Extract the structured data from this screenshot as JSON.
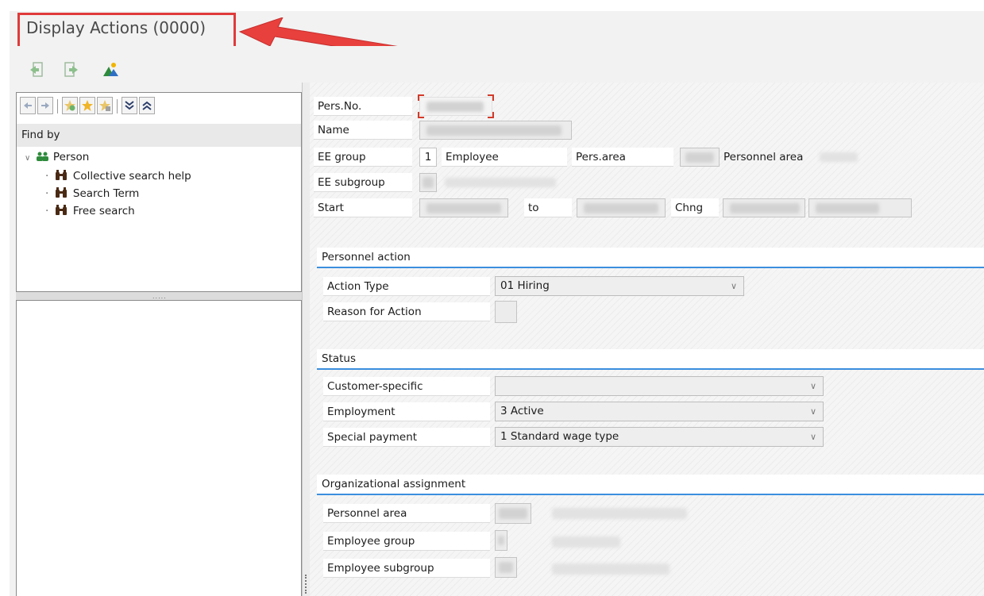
{
  "window": {
    "title": "Display Actions (0000)"
  },
  "toolbar": {
    "buttons": [
      "back-to-list-icon",
      "forward-icon",
      "org-structure-icon"
    ]
  },
  "navigator": {
    "toolbar_icons": [
      "arrow-left-icon",
      "arrow-right-icon",
      "add-favorite-icon",
      "star-icon",
      "delete-favorite-icon",
      "expand-all-icon",
      "collapse-all-icon"
    ],
    "find_by_label": "Find by",
    "tree": {
      "root_label": "Person",
      "children": [
        "Collective search help",
        "Search Term",
        "Free search"
      ]
    }
  },
  "header": {
    "pers_no_label": "Pers.No.",
    "name_label": "Name",
    "ee_group_label": "EE group",
    "ee_group_value": "1",
    "ee_group_text": "Employee",
    "pers_area_label": "Pers.area",
    "personnel_area_text": "Personnel area",
    "ee_subgroup_label": "EE subgroup",
    "start_label": "Start",
    "to_label": "to",
    "chng_label": "Chng"
  },
  "personnel_action": {
    "title": "Personnel action",
    "action_type_label": "Action Type",
    "action_type_value": "01 Hiring",
    "reason_label": "Reason for Action"
  },
  "status": {
    "title": "Status",
    "customer_label": "Customer-specific",
    "customer_value": "",
    "employment_label": "Employment",
    "employment_value": "3 Active",
    "special_payment_label": "Special payment",
    "special_payment_value": "1 Standard wage type"
  },
  "org_assignment": {
    "title": "Organizational assignment",
    "personnel_area_label": "Personnel area",
    "employee_group_label": "Employee group",
    "employee_subgroup_label": "Employee subgroup"
  },
  "colors": {
    "annotation_red": "#e03a3a",
    "group_accent_blue": "#3b8ede",
    "person_icon_green": "#2e8b3c"
  }
}
